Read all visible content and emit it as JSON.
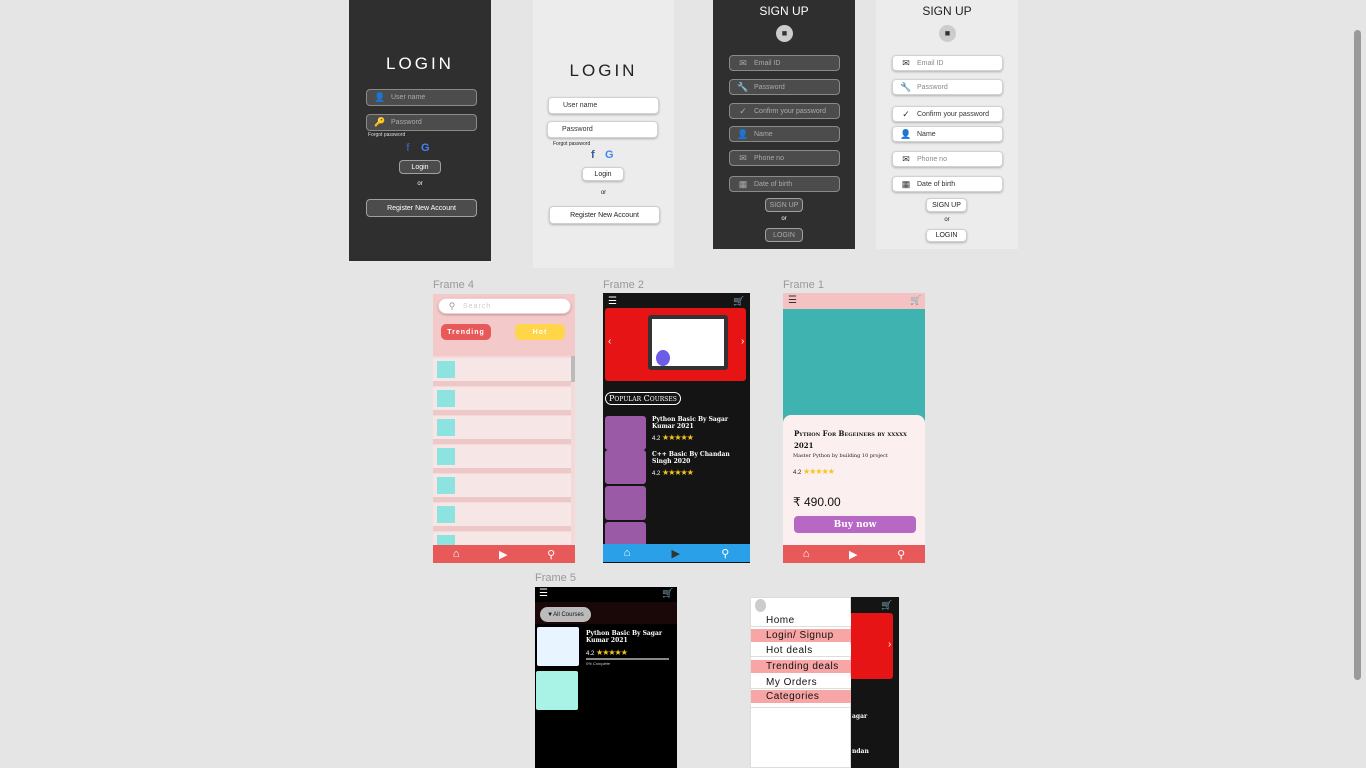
{
  "login_dark": {
    "title": "LOGIN",
    "username_placeholder": "User name",
    "password_placeholder": "Password",
    "forgot": "Forgot password",
    "login_btn": "Login",
    "or": "or",
    "register_btn": "Register New Account"
  },
  "login_light": {
    "title": "LOGIN",
    "username_placeholder": "User name",
    "password_placeholder": "Password",
    "forgot": "Forgot password",
    "login_btn": "Login",
    "or": "or",
    "register_btn": "Register New Account"
  },
  "signup_dark": {
    "title": "SIGN UP",
    "fields": [
      "Email ID",
      "Password",
      "Confirm your password",
      "Name",
      "Phone no",
      "Date of birth"
    ],
    "signup_btn": "SIGN UP",
    "or": "or",
    "login_btn": "LOGIN"
  },
  "signup_light": {
    "title": "SIGN UP",
    "fields": [
      "Email ID",
      "Password",
      "Confirm your password",
      "Name",
      "Phone no",
      "Date of birth"
    ],
    "signup_btn": "SIGN UP",
    "or": "or",
    "login_btn": "LOGIN"
  },
  "frame_labels": {
    "f4": "Frame 4",
    "f2": "Frame 2",
    "f1": "Frame 1",
    "f5": "Frame 5"
  },
  "frame4": {
    "search_placeholder": "Search",
    "trending": "Trending",
    "hot": "Hot",
    "accent": "#e85a5a"
  },
  "frame2": {
    "section_title": "Popular Courses",
    "courses": [
      {
        "title": "Python Basic By Sagar Kumar 2021",
        "rating": "4.2"
      },
      {
        "title": "C++ Basic By Chandan Singh 2020",
        "rating": "4.2"
      }
    ]
  },
  "frame1": {
    "course_title": "Python For Begeiners by xxxxx 2021",
    "subtitle": "Master Python by building 10 project",
    "rating": "4.2",
    "price": "₹ 490.00",
    "buy": "Buy now"
  },
  "frame5": {
    "filter": "All Courses",
    "course_title": "Python Basic By Sagar Kumar 2021",
    "rating": "4.2",
    "progress_label": "0% Complete",
    "progress": 0
  },
  "menu": {
    "items": [
      "Home",
      "Login/ Signup",
      "Hot deals",
      "Trending deals",
      "My Orders",
      "Categories"
    ],
    "peek1": "agar",
    "peek2": "ndan"
  },
  "colors": {
    "dark": "#2f2f2f",
    "light": "#ececec",
    "red": "#e85a5a",
    "blue": "#2aa0e8",
    "purple": "#9b5aa5",
    "teal": "#3fb3b0",
    "pink": "#f4c2c2"
  }
}
